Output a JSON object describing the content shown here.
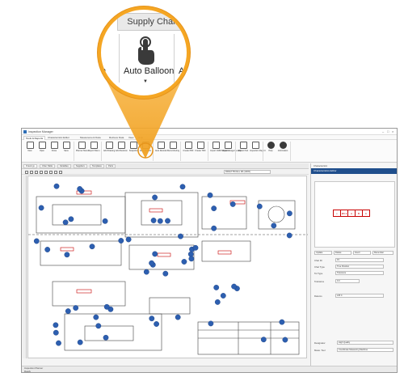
{
  "window": {
    "title": "Inspection Manager",
    "menus": [
      "Tools & Reports",
      "Characteristic Editor",
      "Measurement Data",
      "Retrieve Data",
      "View",
      "Help"
    ],
    "active_menu_index": 0
  },
  "ribbon": {
    "buttons": [
      {
        "label": "New",
        "icon": "new-document-icon"
      },
      {
        "label": "Open",
        "icon": "open-folder-icon"
      },
      {
        "label": "Close",
        "icon": "close-file-icon"
      },
      {
        "label": "Save",
        "icon": "save-icon"
      },
      {
        "label": "Planner Menu",
        "icon": "planner-icon"
      },
      {
        "label": "Report Menu",
        "icon": "report-icon"
      },
      {
        "label": "Add Drawing",
        "icon": "add-drawing-icon"
      },
      {
        "label": "Add Revision",
        "icon": "add-revision-icon"
      },
      {
        "label": "Snapshot",
        "icon": "snapshot-icon"
      },
      {
        "label": "Auto Balloon",
        "icon": "pointer-icon"
      },
      {
        "label": "Auto Reorder",
        "icon": "reorder-icon"
      },
      {
        "label": "Renumbering",
        "icon": "renumber-icon"
      },
      {
        "label": "Create PDF",
        "icon": "pdf-icon"
      },
      {
        "label": "Create TIFF",
        "icon": "tiff-icon"
      },
      {
        "label": "Import CMM Measure",
        "icon": "import-icon"
      },
      {
        "label": "Import Image Results",
        "icon": "import-image-icon"
      },
      {
        "label": "Export Part",
        "icon": "export-icon"
      },
      {
        "label": "Inspection Report",
        "icon": "inspection-report-icon"
      },
      {
        "label": "Help",
        "icon": "help-icon"
      },
      {
        "label": "Information",
        "icon": "info-icon"
      }
    ]
  },
  "document_tabs": [
    "Drawings",
    "Char. Table",
    "Variables",
    "Suppliers",
    "Templates",
    "Parts"
  ],
  "drawing": {
    "sheet_label": "RD3A7750 Rev 1B (100%)",
    "balloon_count": 60
  },
  "right_pane": {
    "header": "Characteristics Editor",
    "tab_label": "Characteristic",
    "fcf_values": [
      "⌖",
      "Ø0.3",
      "A",
      "B",
      "C"
    ],
    "fields": [
      {
        "label": "Char ID",
        "value": "15"
      },
      {
        "label": "Char Type",
        "value": "True Position"
      },
      {
        "label": "Tol Type",
        "value": "Tolerance"
      },
      {
        "label": "Tolerance",
        "value": "0.3"
      },
      {
        "label": "Datums",
        "value": "A B C"
      },
      {
        "label": "Designator",
        "value": "High Quality"
      },
      {
        "label": "Meas. Tool",
        "value": "Coordinate Measuring Machine"
      }
    ],
    "buttons": [
      "Update",
      "Delete",
      "Insert",
      "Renumber"
    ]
  },
  "status": {
    "label": "Inspection Planner",
    "state": "Ready"
  },
  "callout": {
    "tab": "Supply Chain",
    "button_label": "Auto Balloon",
    "left_partial": "n",
    "right_partial": "Au",
    "accent": "#f5a623"
  }
}
